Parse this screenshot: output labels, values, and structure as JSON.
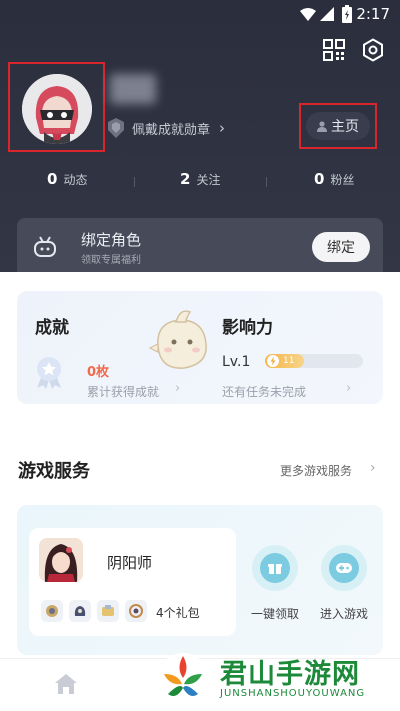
{
  "status_bar": {
    "time": "2:17"
  },
  "profile": {
    "badge_label": "佩戴成就勋章",
    "home_label": "主页",
    "stats": [
      {
        "value": "0",
        "label": "动态"
      },
      {
        "value": "2",
        "label": "关注"
      },
      {
        "value": "0",
        "label": "粉丝"
      }
    ]
  },
  "bind_card": {
    "title": "绑定角色",
    "subtitle": "领取专属福利",
    "button": "绑定"
  },
  "achievement": {
    "title": "成就",
    "count": "0枚",
    "subtitle": "累计获得成就"
  },
  "influence": {
    "title": "影响力",
    "level": "Lv.1",
    "progress_text": "11",
    "progress_fraction": 0.4,
    "subtitle": "还有任务未完成"
  },
  "game_services": {
    "title": "游戏服务",
    "more_label": "更多游戏服务",
    "game": {
      "name": "阴阳师",
      "gift_count": "4个礼包"
    },
    "actions": [
      {
        "label": "一键领取"
      },
      {
        "label": "进入游戏"
      }
    ]
  },
  "watermark": {
    "title": "君山手游网",
    "subtitle": "JUNSHANSHOUYOUWANG"
  },
  "colors": {
    "header_bg": "#2b2e3d",
    "highlight_box": "#d8262c",
    "achievement_count": "#f06a4b",
    "accent_teal": "#7ccbe0"
  }
}
